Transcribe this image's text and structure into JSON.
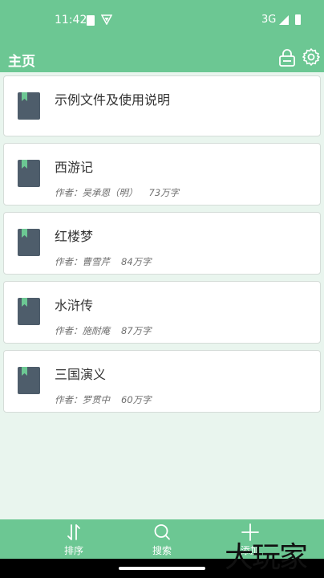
{
  "status_bar": {
    "time": "11:42",
    "network": "3G"
  },
  "app_bar": {
    "title": "主页",
    "lock_icon": "lock-icon",
    "settings_icon": "gear-icon"
  },
  "books": [
    {
      "title": "示例文件及使用说明"
    },
    {
      "title": "西游记",
      "author": "作者：吴承恩（明）",
      "count": "73万字"
    },
    {
      "title": "红楼梦",
      "author": "作者：曹雪芹",
      "count": "84万字"
    },
    {
      "title": "水浒传",
      "author": "作者：施耐庵",
      "count": "87万字"
    },
    {
      "title": "三国演义",
      "author": "作者：罗贯中",
      "count": "60万字"
    }
  ],
  "bottom_nav": {
    "sort_label": "排序",
    "search_label": "搜索",
    "add_label": "添加"
  },
  "watermark": "大玩家",
  "colors": {
    "accent": "#6cc793",
    "background": "#e9f5ee",
    "book_cover": "#4e5d6b",
    "bookmark": "#6cc793"
  }
}
